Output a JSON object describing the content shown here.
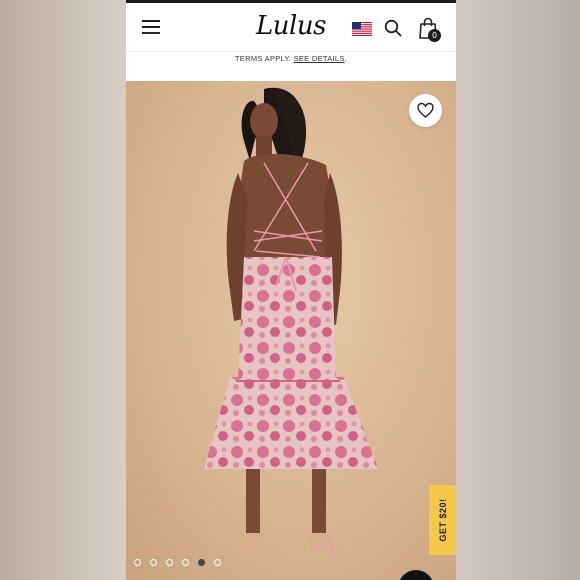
{
  "header": {
    "logo_text": "Lulus",
    "icons": [
      "menu-icon",
      "us-flag-icon",
      "search-icon",
      "shopping-bag-icon"
    ],
    "bag_count": "0"
  },
  "promo": {
    "text": "TERMS APPLY.",
    "link": "SEE DETAILS",
    "suffix": "."
  },
  "hero": {
    "description": "Model wearing pink floral organza midi dress with lace-up open back, beige heels",
    "wishlist_icon": "heart-icon",
    "carousel_total": 6,
    "carousel_active": 5
  },
  "side_tab": {
    "label": "GET $20!",
    "color": "#f4c94a"
  },
  "colors": {
    "hero_bg": "#d9b592",
    "dress_pink": "#d9728f",
    "dress_light": "#e8c7c6",
    "skin": "#7a4a35",
    "heels": "#d7ad8f"
  }
}
